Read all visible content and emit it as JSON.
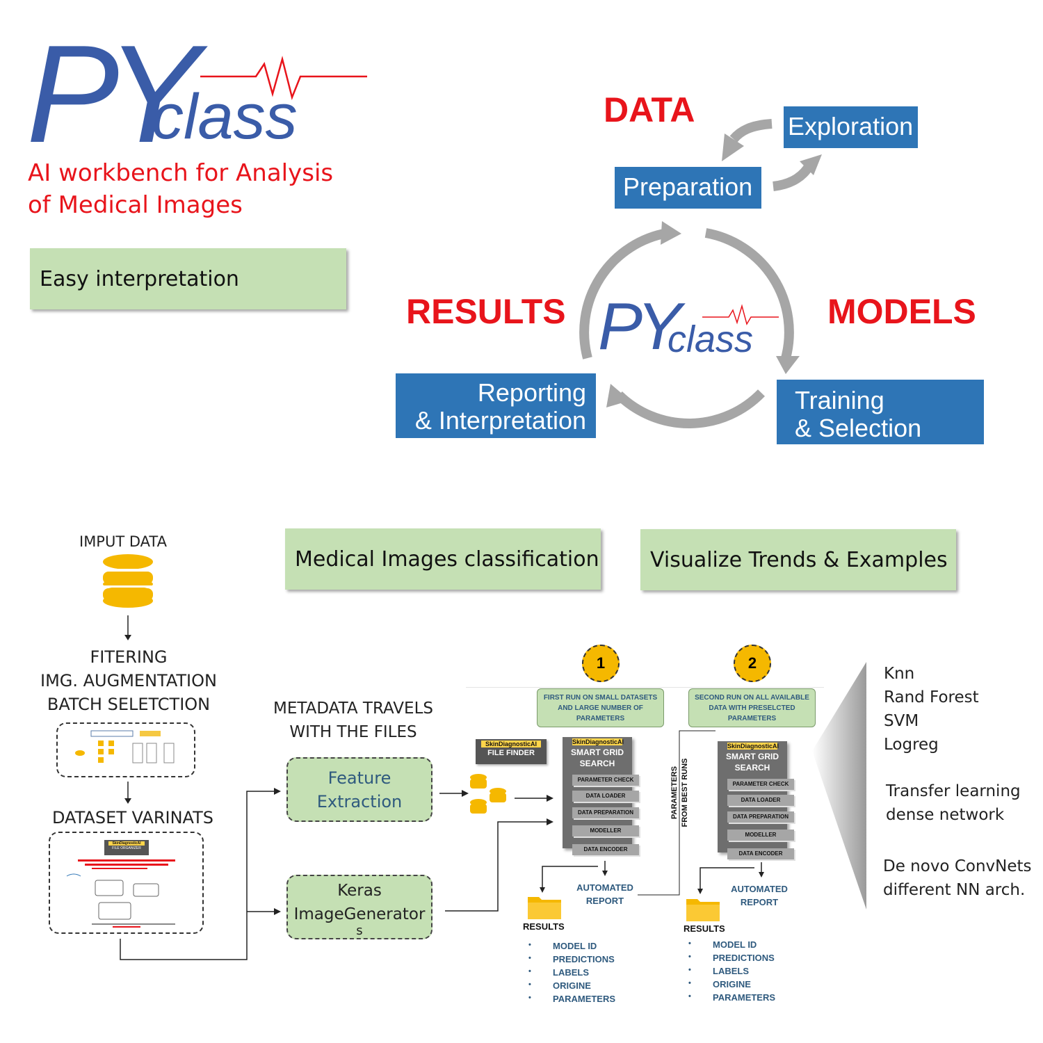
{
  "logo": {
    "py": "PY",
    "class": "class",
    "tagline": [
      "AI workbench for Analysis",
      "of Medical Images"
    ]
  },
  "features": {
    "easy": "Easy interpretation",
    "classification": "Medical Images classification",
    "visualize": "Visualize Trends & Examples"
  },
  "cycle": {
    "data": "DATA",
    "results": "RESULTS",
    "models": "MODELS",
    "exploration": "Exploration",
    "preparation": "Preparation",
    "reporting": [
      "Reporting",
      "& Interpretation"
    ],
    "training": [
      "Training",
      "& Selection"
    ],
    "center_logo": {
      "py": "PY",
      "class": "class"
    }
  },
  "pipeline": {
    "input": "IMPUT DATA",
    "filtering": [
      "FITERING",
      "IMG. AUGMENTATION",
      "BATCH SELETCTION"
    ],
    "variants": "DATASET VARINATS",
    "metadata": [
      "METADATA TRAVELS",
      "WITH THE FILES"
    ],
    "feature_extraction": [
      "Feature",
      "Extraction"
    ],
    "keras": [
      "Keras",
      "ImageGenerator",
      "s"
    ],
    "file_organizer": {
      "brand": "SkinDiagnosticAI",
      "title": "FILE ORGANIZER"
    },
    "file_finder": {
      "brand": "SkinDiagnosticAI",
      "title": "FILE FINDER"
    },
    "run1": {
      "number": "1",
      "note": [
        "FIRST RUN ON SMALL DATASETS",
        "AND LARGE NUMBER  OF",
        "PARAMETERS"
      ],
      "brand": "SkinDiagnosticAI",
      "title": [
        "SMART GRID",
        "SEARCH"
      ],
      "steps": [
        "PARAMETER CHECK",
        "DATA LOADER",
        "DATA PREPARATION",
        "MODELLER",
        "DATA ENCODER"
      ],
      "report": [
        "AUTOMATED",
        "REPORT"
      ]
    },
    "run2": {
      "number": "2",
      "note": [
        "SECOND RUN ON ALL AVAILABLE",
        "DATA WITH PRESELCTED",
        "PARAMETERS"
      ],
      "brand": "SkinDiagnosticAI",
      "title": [
        "SMART GRID",
        "SEARCH"
      ],
      "steps": [
        "PARAMETER CHECK",
        "DATA LOADER",
        "DATA PREPARATION",
        "MODELLER",
        "DATA ENCODER"
      ],
      "report": [
        "AUTOMATED",
        "REPORT"
      ]
    },
    "params_from_best": [
      "PARAMETERS",
      "FROM BEST RUNS"
    ],
    "results_label": "RESULTS",
    "results_items": [
      "MODEL ID",
      "PREDICTIONS",
      "LABELS",
      "ORIGINE",
      "PARAMETERS"
    ]
  },
  "models_list": {
    "group1": [
      "Knn",
      "Rand Forest",
      "SVM",
      "Logreg"
    ],
    "group2": [
      "Transfer learning",
      "dense network"
    ],
    "group3": [
      "De novo ConvNets",
      "different NN arch."
    ]
  },
  "colors": {
    "red": "#e8141b",
    "blue": "#2e75b6",
    "green": "#c5e0b4",
    "logo_blue": "#3a5ca8",
    "grey": "#a6a6a6",
    "gold": "#f5b800"
  }
}
